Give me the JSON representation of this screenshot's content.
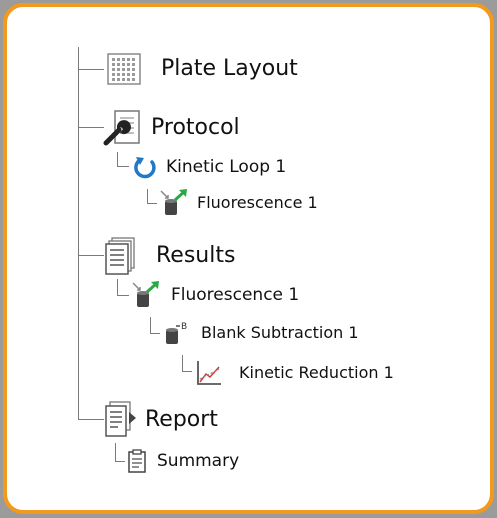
{
  "tree": {
    "plate_layout": {
      "label": "Plate Layout",
      "icon": "grid-plate-icon"
    },
    "protocol": {
      "label": "Protocol",
      "icon": "wrench-document-icon",
      "kinetic_loop": {
        "label": "Kinetic Loop 1",
        "icon": "loop-arrow-icon"
      },
      "fluorescence": {
        "label": "Fluorescence 1",
        "icon": "fluorescence-icon"
      }
    },
    "results": {
      "label": "Results",
      "icon": "stacked-documents-icon",
      "fluorescence": {
        "label": "Fluorescence 1",
        "icon": "fluorescence-icon"
      },
      "blank_subtraction": {
        "label": "Blank Subtraction 1",
        "icon": "blank-subtraction-icon"
      },
      "kinetic_reduction": {
        "label": "Kinetic Reduction 1",
        "icon": "kinetic-chart-icon"
      }
    },
    "report": {
      "label": "Report",
      "icon": "report-document-icon",
      "summary": {
        "label": "Summary",
        "icon": "clipboard-icon"
      }
    }
  },
  "colors": {
    "border_accent": "#f29a1f",
    "loop_blue": "#1f78c8",
    "arrow_green": "#2aa845",
    "tree_line": "#7a7a7a"
  }
}
